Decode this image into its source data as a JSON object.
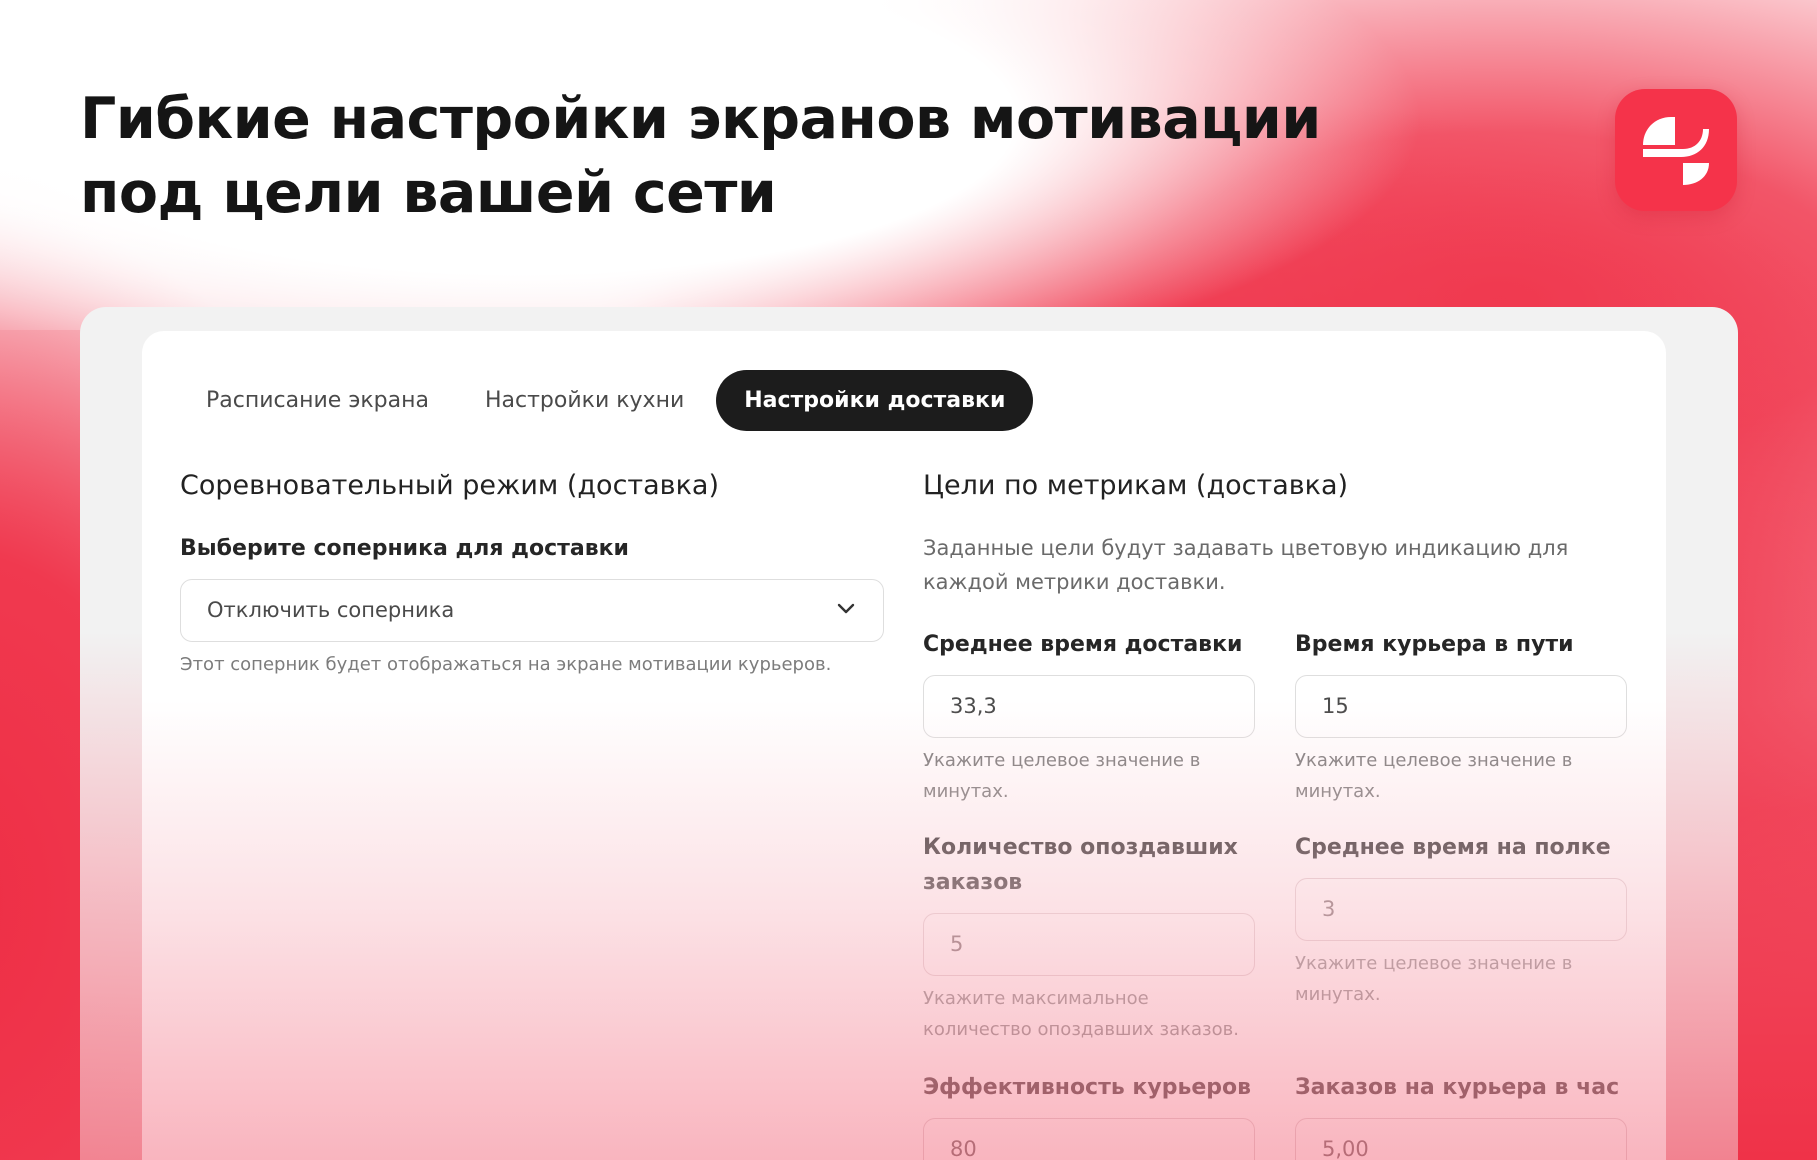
{
  "headline": {
    "line1": "Гибкие настройки экранов мотивации",
    "line2": "под цели вашей сети"
  },
  "logo": {
    "icon": "brand-logo-icon",
    "color": "#f5334a"
  },
  "tabs": [
    {
      "label": "Расписание экрана",
      "active": false
    },
    {
      "label": "Настройки кухни",
      "active": false
    },
    {
      "label": "Настройки доставки",
      "active": true
    }
  ],
  "left": {
    "title": "Соревновательный режим (доставка)",
    "rival_label": "Выберите соперника для доставки",
    "rival_value": "Отключить соперника",
    "rival_help": "Этот соперник будет отображаться на экране мотивации курьеров."
  },
  "right": {
    "title": "Цели по метрикам (доставка)",
    "description_line1": "Заданные цели будут задавать цветовую индикацию для",
    "description_line2": "каждой метрики доставки.",
    "fields": [
      {
        "label_line1": "Среднее время доставки",
        "label_line2": "",
        "value": "33,3",
        "help_line1": "Укажите целевое значение в",
        "help_line2": "минутах."
      },
      {
        "label_line1": "Время курьера в пути",
        "label_line2": "",
        "value": "15",
        "help_line1": "Укажите целевое значение в",
        "help_line2": "минутах."
      },
      {
        "label_line1": "Количество опоздавших",
        "label_line2": "заказов",
        "value": "5",
        "help_line1": "Укажите максимальное",
        "help_line2": "количество опоздавших заказов."
      },
      {
        "label_line1": "Среднее время на полке",
        "label_line2": "",
        "value": "3",
        "help_line1": "Укажите целевое значение в",
        "help_line2": "минутах."
      },
      {
        "label_line1": "Эффективность курьеров",
        "label_line2": "",
        "value": "80",
        "help_line1": "",
        "help_line2": ""
      },
      {
        "label_line1": "Заказов на курьера в час",
        "label_line2": "",
        "value": "5,00",
        "help_line1": "",
        "help_line2": ""
      }
    ]
  },
  "colors": {
    "accent": "#f0394f",
    "active_tab": "#1c1c1c"
  }
}
